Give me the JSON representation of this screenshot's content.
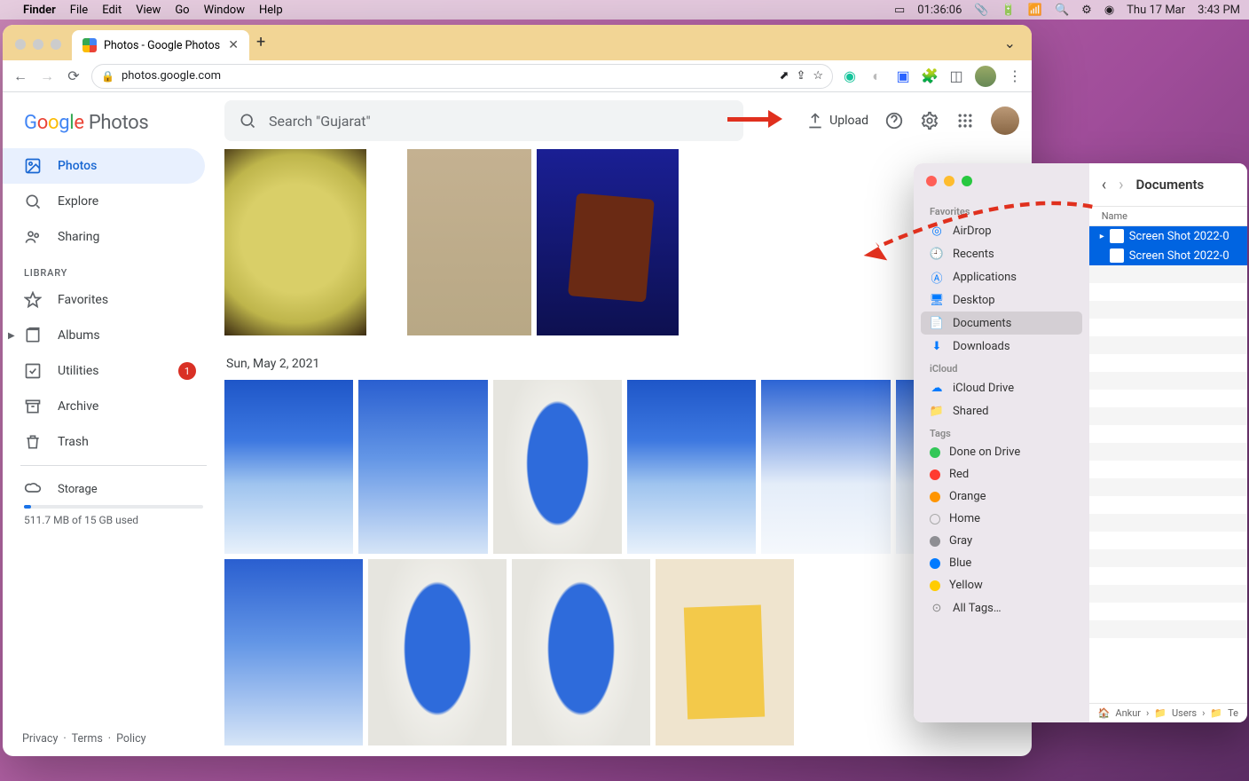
{
  "menubar": {
    "appname": "Finder",
    "menus": [
      "File",
      "Edit",
      "View",
      "Go",
      "Window",
      "Help"
    ],
    "clock": "01:36:06",
    "date": "Thu 17 Mar",
    "time": "3:43 PM"
  },
  "chrome": {
    "tab_title": "Photos - Google Photos",
    "url": "photos.google.com"
  },
  "gp": {
    "logo_parts": {
      "g": "G",
      "o1": "o",
      "o2": "o",
      "g2": "g",
      "l": "l",
      "e": "e",
      "photos": " Photos"
    },
    "search_placeholder": "Search \"Gujarat\"",
    "upload_label": "Upload",
    "nav": {
      "photos": "Photos",
      "explore": "Explore",
      "sharing": "Sharing",
      "library_label": "LIBRARY",
      "favorites": "Favorites",
      "albums": "Albums",
      "utilities": "Utilities",
      "utilities_badge": "1",
      "archive": "Archive",
      "trash": "Trash",
      "storage": "Storage",
      "storage_used": "511.7 MB of 15 GB used"
    },
    "date_header": "Sun, May 2, 2021",
    "footer": {
      "privacy": "Privacy",
      "dot1": "·",
      "terms": "Terms",
      "dot2": "·",
      "policy": "Policy"
    }
  },
  "finder": {
    "title": "Documents",
    "col_name": "Name",
    "sections": {
      "favorites": "Favorites",
      "icloud": "iCloud",
      "tags": "Tags"
    },
    "favorites": [
      "AirDrop",
      "Recents",
      "Applications",
      "Desktop",
      "Documents",
      "Downloads"
    ],
    "icloud": [
      "iCloud Drive",
      "Shared"
    ],
    "tags": [
      "Done on Drive",
      "Red",
      "Orange",
      "Home",
      "Gray",
      "Blue",
      "Yellow",
      "All Tags…"
    ],
    "files": [
      "Screen Shot 2022-0",
      "Screen Shot 2022-0"
    ],
    "path": {
      "user": "Ankur",
      "users": "Users",
      "cut": "Te"
    }
  }
}
